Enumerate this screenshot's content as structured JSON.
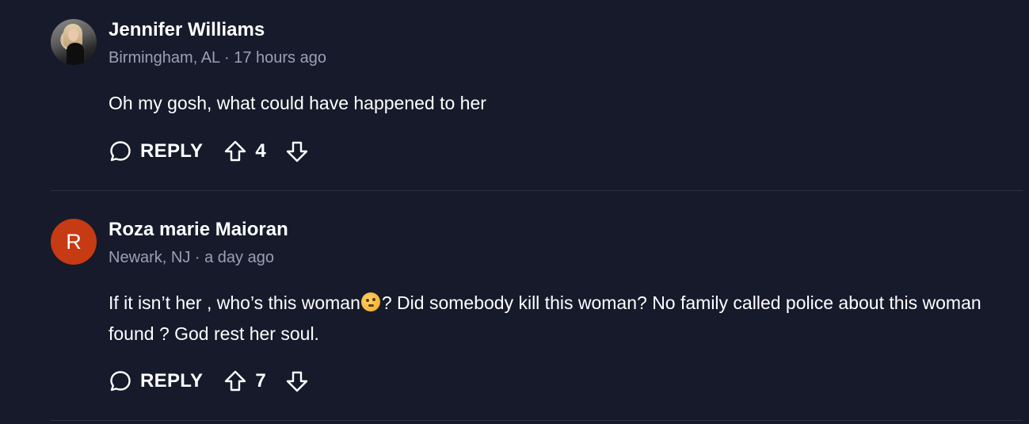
{
  "comments": [
    {
      "author": "Jennifer Williams",
      "meta": "Birmingham, AL · 17 hours ago",
      "avatar_type": "photo",
      "text": "Oh my gosh, what could have happened to her",
      "reply_label": "REPLY",
      "upvotes": "4"
    },
    {
      "author": "Roza marie Maioran",
      "meta": "Newark, NJ · a day ago",
      "avatar_type": "letter",
      "avatar_letter": "R",
      "avatar_color": "#c63a14",
      "text_before_emoji": "If it isn’t her , who’s this woman",
      "emoji_name": "thinking-face-emoji",
      "text_after_emoji": "? Did somebody kill this woman? No family called police about this woman found ? God rest her soul.",
      "reply_label": "REPLY",
      "upvotes": "7"
    }
  ],
  "colors": {
    "background": "#161a2b",
    "text": "#ffffff",
    "meta": "#9aa0b4",
    "divider": "#2c3144"
  },
  "icons": {
    "reply": "speech-bubble-icon",
    "upvote": "arrow-up-icon",
    "downvote": "arrow-down-icon"
  }
}
